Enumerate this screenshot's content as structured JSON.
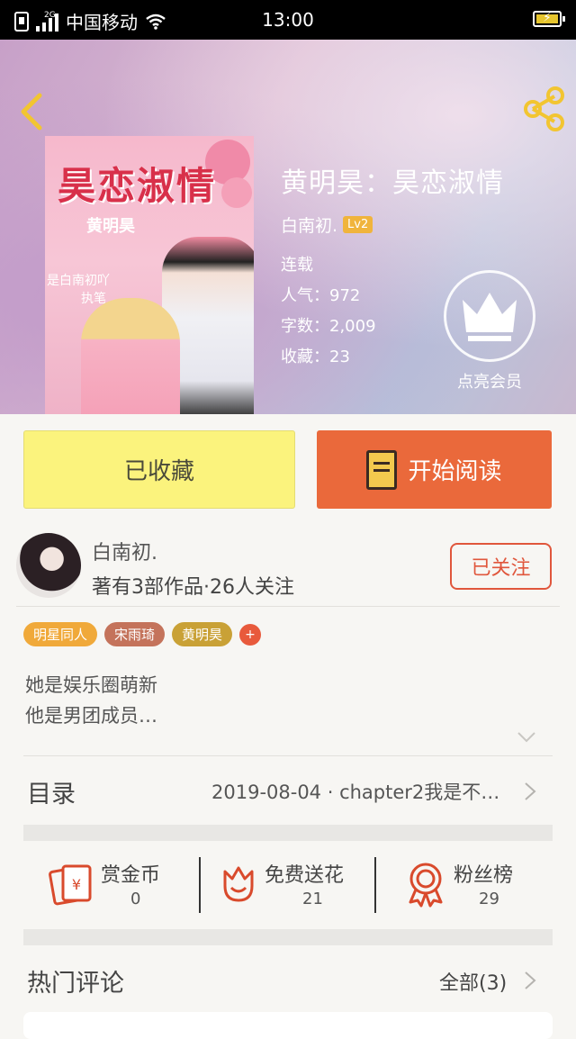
{
  "status_bar": {
    "network_type": "2G",
    "carrier": "中国移动",
    "time": "13:00"
  },
  "book": {
    "cover": {
      "title": "昊恋淑情",
      "author": "黄明昊",
      "line1": "是白南初吖",
      "line2": "执笔"
    },
    "title": "黄明昊：昊恋淑情",
    "author": "白南初.",
    "level": "Lv2",
    "status": "连载",
    "popularity": "人气：972",
    "word_count": "字数：2,009",
    "favorites": "收藏：23",
    "member_label": "点亮会员"
  },
  "actions": {
    "favorite_label": "已收藏",
    "read_label": "开始阅读"
  },
  "author_card": {
    "name": "白南初.",
    "meta": "著有3部作品·26人关注",
    "follow_label": "已关注"
  },
  "tags": [
    {
      "label": "明星同人",
      "color": "#f0a93a"
    },
    {
      "label": "宋雨琦",
      "color": "#c4735b"
    },
    {
      "label": "黄明昊",
      "color": "#c9a136"
    }
  ],
  "tag_add": "+",
  "intro": {
    "line1": "她是娱乐圈萌新",
    "line2": "他是男团成员…"
  },
  "toc": {
    "label": "目录",
    "latest": "2019-08-04 · chapter2我是不…"
  },
  "rewards": [
    {
      "label": "赏金币",
      "value": "0"
    },
    {
      "label": "免费送花",
      "value": "21"
    },
    {
      "label": "粉丝榜",
      "value": "29"
    }
  ],
  "comments": {
    "title": "热门评论",
    "all_label": "全部(3)"
  },
  "colors": {
    "accent_orange": "#ea693b",
    "favorite_yellow": "#fbf37d",
    "follow_red": "#e0563c",
    "icon_red": "#d94a2c"
  }
}
